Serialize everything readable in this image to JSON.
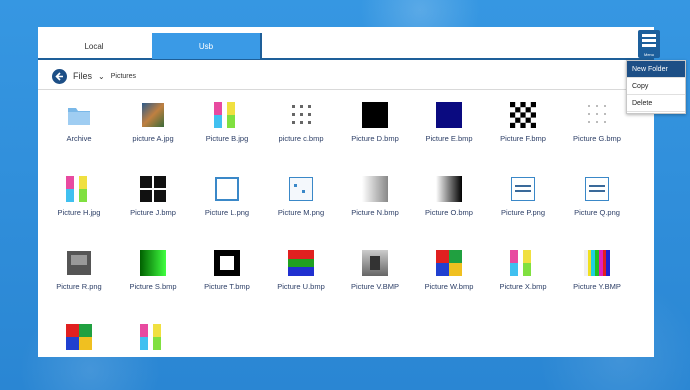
{
  "tabs": {
    "local": "Local",
    "usb": "Usb"
  },
  "menu_button": {
    "caption": "Menu",
    "icon": "hamburger-icon"
  },
  "breadcrumb": {
    "root": "Files",
    "current": "Pictures"
  },
  "dropdown": {
    "items": [
      "New Folder",
      "Copy",
      "Delete"
    ]
  },
  "files": [
    {
      "name": "Archive",
      "icon": "folder-icon"
    },
    {
      "name": "picture A.jpg",
      "icon": "photo-thumbnail"
    },
    {
      "name": "Picture B.jpg",
      "icon": "color-bars-thumbnail"
    },
    {
      "name": "picture c.bmp",
      "icon": "dots-thumbnail"
    },
    {
      "name": "Picture D.bmp",
      "icon": "black-thumbnail"
    },
    {
      "name": "Picture E.bmp",
      "icon": "navy-thumbnail"
    },
    {
      "name": "Picture F.bmp",
      "icon": "checker-thumbnail"
    },
    {
      "name": "Picture G.bmp",
      "icon": "dots-light-thumbnail"
    },
    {
      "name": "Picture H.jpg",
      "icon": "color-bars-thumbnail"
    },
    {
      "name": "Picture J.bmp",
      "icon": "black-pattern-thumbnail"
    },
    {
      "name": "Picture L.png",
      "icon": "frame-thumbnail"
    },
    {
      "name": "Picture M.png",
      "icon": "frame-dots-thumbnail"
    },
    {
      "name": "Picture N.bmp",
      "icon": "gradient-light-thumbnail"
    },
    {
      "name": "Picture O.bmp",
      "icon": "gradient-dark-thumbnail"
    },
    {
      "name": "Picture P.png",
      "icon": "text-frame-thumbnail"
    },
    {
      "name": "Picture Q.png",
      "icon": "text-frame-thumbnail"
    },
    {
      "name": "Picture R.png",
      "icon": "gray-frame-thumbnail"
    },
    {
      "name": "Picture S.bmp",
      "icon": "green-gradient-thumbnail"
    },
    {
      "name": "Picture T.bmp",
      "icon": "black-border-thumbnail"
    },
    {
      "name": "Picture U.bmp",
      "icon": "rgb-stripes-thumbnail"
    },
    {
      "name": "Picture V.BMP",
      "icon": "gray-photo-thumbnail"
    },
    {
      "name": "Picture W.bmp",
      "icon": "quad-color-thumbnail"
    },
    {
      "name": "Picture X.bmp",
      "icon": "color-bars-thumbnail"
    },
    {
      "name": "Picture Y.BMP",
      "icon": "test-pattern-thumbnail"
    },
    {
      "name": "",
      "icon": "quad-color-thumbnail"
    },
    {
      "name": "",
      "icon": "color-bars-thumbnail"
    }
  ]
}
